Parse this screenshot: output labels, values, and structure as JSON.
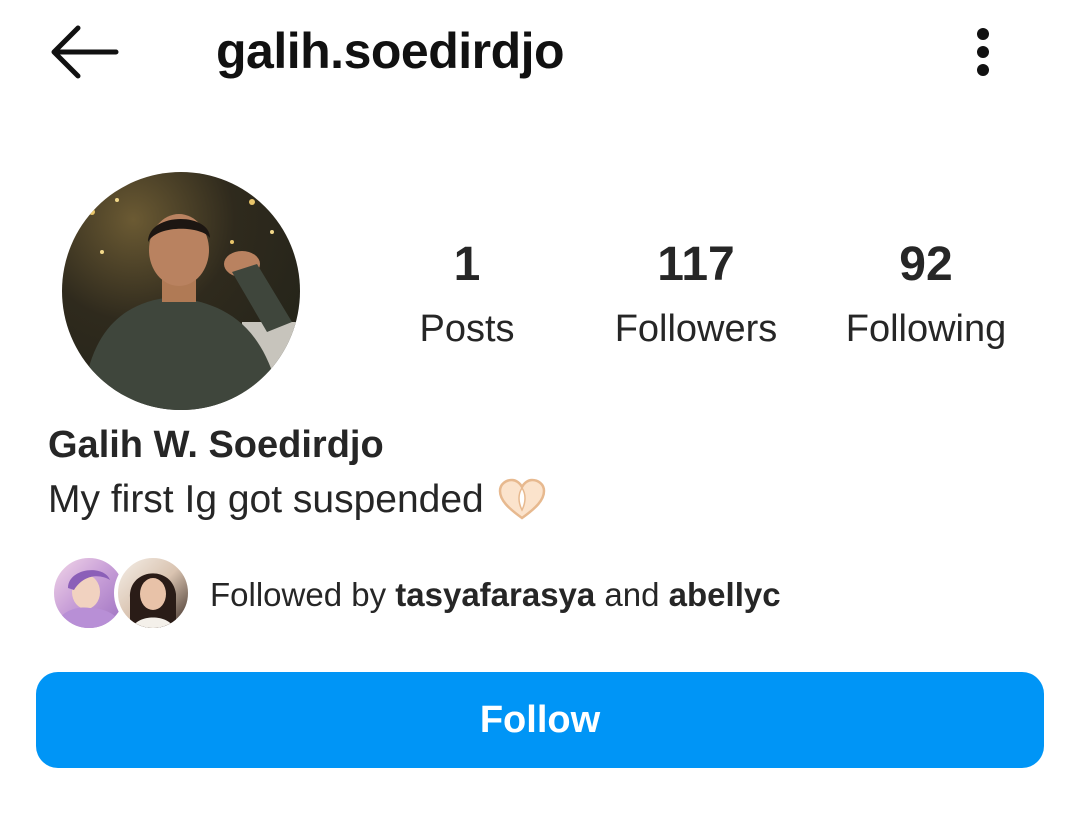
{
  "header": {
    "username": "galih.soedirdjo",
    "back_icon": "arrow-left-icon",
    "more_icon": "vertical-ellipsis-icon"
  },
  "profile": {
    "stats": {
      "posts": {
        "count": "1",
        "label": "Posts"
      },
      "followers": {
        "count": "117",
        "label": "Followers"
      },
      "following": {
        "count": "92",
        "label": "Following"
      }
    },
    "full_name": "Galih W. Soedirdjo",
    "bio": "My first Ig got suspended",
    "bio_emoji_icon": "heart-hands-icon"
  },
  "mutuals": {
    "prefix": "Followed by ",
    "user1": "tasyafarasya",
    "connector": " and ",
    "user2": "abellyc"
  },
  "actions": {
    "follow_label": "Follow"
  },
  "colors": {
    "accent": "#0095f6",
    "text": "#262626"
  }
}
